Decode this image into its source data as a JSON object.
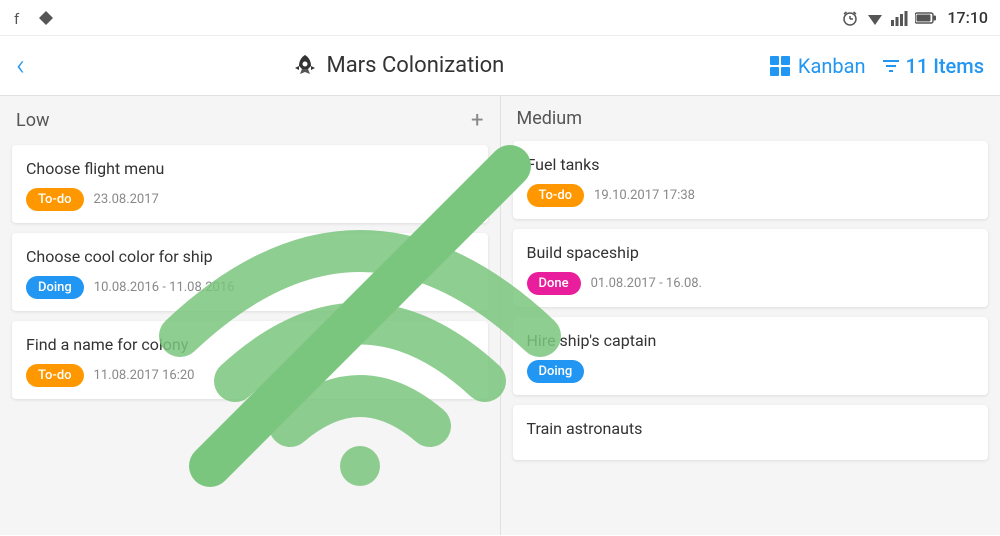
{
  "statusBar": {
    "time": "17:10",
    "icons": [
      "alarm",
      "wifi",
      "signal",
      "battery"
    ]
  },
  "header": {
    "backLabel": "‹",
    "title": "Mars Colonization",
    "kanbanLabel": "Kanban",
    "itemsLabel": "11 Items"
  },
  "columns": [
    {
      "id": "low",
      "title": "Low",
      "showAdd": true,
      "cards": [
        {
          "id": "card-1",
          "title": "Choose flight menu",
          "badge": "To-do",
          "badgeType": "todo",
          "date": "23.08.2017",
          "dateTime": ""
        },
        {
          "id": "card-2",
          "title": "Choose cool color for ship",
          "badge": "Doing",
          "badgeType": "doing",
          "date": "10.08.2016 - 11.08.2016",
          "dateTime": ""
        },
        {
          "id": "card-3",
          "title": "Find a name for colony",
          "badge": "To-do",
          "badgeType": "todo",
          "date": "11.08.2017",
          "dateTime": "16:20"
        }
      ]
    },
    {
      "id": "medium",
      "title": "Medium",
      "showAdd": false,
      "cards": [
        {
          "id": "card-4",
          "title": "Fuel tanks",
          "badge": "To-do",
          "badgeType": "todo",
          "date": "19.10.2017",
          "dateTime": "17:38"
        },
        {
          "id": "card-5",
          "title": "Build spaceship",
          "badge": "Done",
          "badgeType": "done",
          "date": "01.08.2017 - 16.08.",
          "dateTime": ""
        },
        {
          "id": "card-6",
          "title": "Hire ship's captain",
          "badge": "Doing",
          "badgeType": "doing",
          "date": "",
          "dateTime": ""
        },
        {
          "id": "card-7",
          "title": "Train astronauts",
          "badge": "",
          "badgeType": "",
          "date": "",
          "dateTime": ""
        }
      ]
    }
  ],
  "noWifi": {
    "visible": true,
    "color": "#7bc67e"
  }
}
